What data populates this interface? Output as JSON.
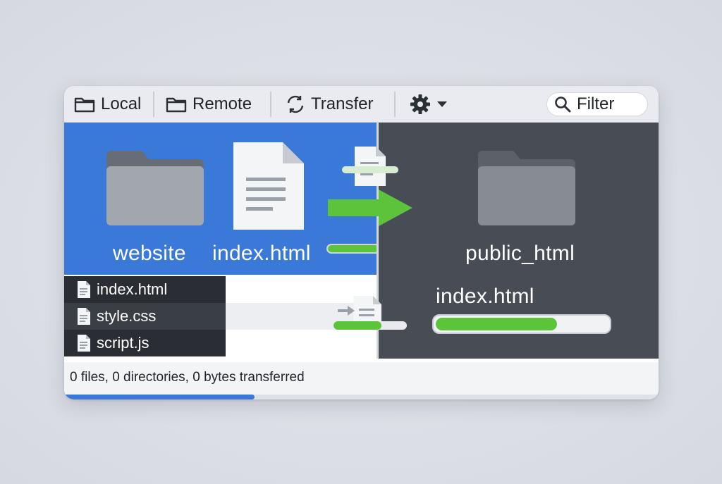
{
  "toolbar": {
    "local_label": "Local",
    "remote_label": "Remote",
    "transfer_label": "Transfer",
    "filter_label": "Filter",
    "icons": {
      "local": "folder-icon",
      "remote": "folder-icon",
      "transfer": "transfer-icon",
      "settings": "gear-icon",
      "dropdown": "chevron-down-icon",
      "filter": "search-icon"
    }
  },
  "local": {
    "folder_name": "website",
    "file_name": "index.html",
    "files": [
      {
        "name": "index.html"
      },
      {
        "name": "style.css"
      },
      {
        "name": "script.js"
      }
    ],
    "upload_progress": 0.6
  },
  "remote": {
    "folder_name": "public_html",
    "transfer_file": "index.html",
    "transfer_progress": 0.7
  },
  "status": {
    "text": "0 files, 0 directories, 0 bytes transferred",
    "progress": 0.32
  },
  "colors": {
    "local_pane": "#3b79d8",
    "remote_pane": "#484d55",
    "progress": "#5cc43a",
    "arrow": "#5cc43a"
  }
}
